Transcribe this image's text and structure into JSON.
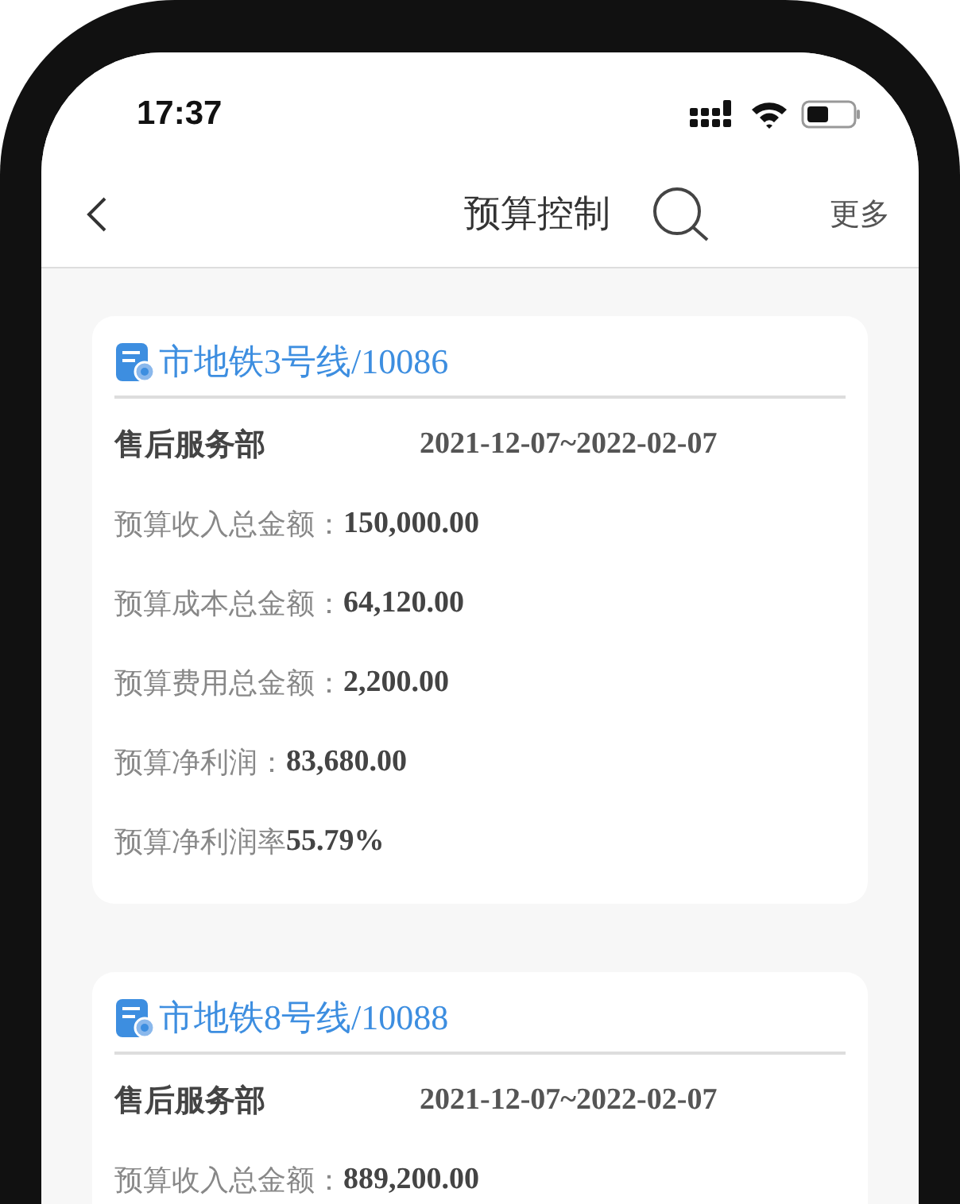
{
  "status_bar": {
    "time": "17:37"
  },
  "nav": {
    "title": "预算控制",
    "more": "更多"
  },
  "cards": [
    {
      "title": "市地铁3号线/10086",
      "department": "售后服务部",
      "period": "2021-12-07~2022-02-07",
      "rows": [
        {
          "label": "预算收入总金额：",
          "value": "150,000.00"
        },
        {
          "label": "预算成本总金额：",
          "value": "64,120.00"
        },
        {
          "label": "预算费用总金额：",
          "value": "2,200.00"
        },
        {
          "label": "预算净利润：",
          "value": "83,680.00"
        },
        {
          "label": "预算净利润率",
          "value": "55.79%"
        }
      ]
    },
    {
      "title": "市地铁8号线/10088",
      "department": "售后服务部",
      "period": "2021-12-07~2022-02-07",
      "rows": [
        {
          "label": "预算收入总金额：",
          "value": "889,200.00"
        }
      ]
    }
  ]
}
